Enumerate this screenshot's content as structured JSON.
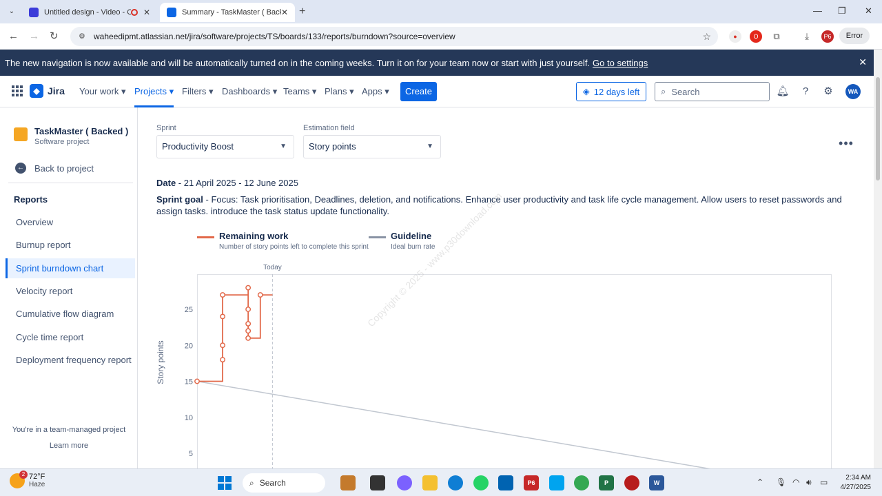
{
  "browser": {
    "tabs": [
      {
        "title": "Untitled design - Video - Ca"
      },
      {
        "title": "Summary - TaskMaster ( Backed"
      }
    ],
    "url": "waheedipmt.atlassian.net/jira/software/projects/TS/boards/133/reports/burndown?source=overview",
    "error_label": "Error"
  },
  "banner": {
    "text": "The new navigation is now available and will be automatically turned on in the coming weeks. Turn it on for your team now or start with just yourself.",
    "link": "Go to settings"
  },
  "topnav": {
    "logo": "Jira",
    "items": [
      "Your work",
      "Projects",
      "Filters",
      "Dashboards",
      "Teams",
      "Plans",
      "Apps"
    ],
    "create": "Create",
    "trial": "12 days left",
    "search_placeholder": "Search",
    "avatar": "WA"
  },
  "sidebar": {
    "project_name": "TaskMaster ( Backed )",
    "project_type": "Software project",
    "back": "Back to project",
    "reports_heading": "Reports",
    "items": [
      "Overview",
      "Burnup report",
      "Sprint burndown chart",
      "Velocity report",
      "Cumulative flow diagram",
      "Cycle time report",
      "Deployment frequency report"
    ],
    "active_item": "Sprint burndown chart",
    "team_note": "You're in a team-managed project",
    "learn_more": "Learn more"
  },
  "filters": {
    "sprint_label": "Sprint",
    "sprint_value": "Productivity Boost",
    "estimation_label": "Estimation field",
    "estimation_value": "Story points"
  },
  "sprint": {
    "date_label": "Date",
    "date_value": " - 21 April 2025 - 12 June 2025",
    "goal_label": "Sprint goal",
    "goal_value": " - Focus: Task prioritisation, Deadlines, deletion, and notifications. Enhance user productivity and task life cycle management. Allow users to reset passwords and assign tasks. introduce the task status update functionality."
  },
  "legend": {
    "remaining_title": "Remaining work",
    "remaining_sub": "Number of story points left to complete this sprint",
    "guideline_title": "Guideline",
    "guideline_sub": "Ideal burn rate"
  },
  "watermark": "Copyright © 2025 - www.p30download.com",
  "colors": {
    "remaining": "#e2694a",
    "guideline": "#8993a4",
    "accent": "#0c66e4",
    "banner": "#253858"
  },
  "chart_data": {
    "type": "line",
    "ylabel": "Story points",
    "today_label": "Today",
    "y_ticks": [
      5,
      10,
      15,
      20,
      25
    ],
    "ylim": [
      3,
      29
    ],
    "xlim": [
      0,
      52
    ],
    "series": [
      {
        "name": "Remaining work",
        "type": "step",
        "x": [
          0,
          2.1,
          2.1,
          2.1,
          2.1,
          2.1,
          4.2,
          4.2,
          4.2,
          4.2,
          4.2,
          5.2,
          5.2,
          6.2
        ],
        "y": [
          15,
          15,
          18,
          20,
          24,
          27,
          27,
          28,
          25,
          22,
          21,
          21,
          27,
          27
        ],
        "markers": [
          [
            0,
            15
          ],
          [
            2.1,
            18
          ],
          [
            2.1,
            20
          ],
          [
            2.1,
            24
          ],
          [
            2.1,
            27
          ],
          [
            4.2,
            28
          ],
          [
            4.2,
            25
          ],
          [
            4.2,
            23
          ],
          [
            4.2,
            22
          ],
          [
            4.2,
            21
          ],
          [
            5.2,
            27
          ]
        ]
      },
      {
        "name": "Guideline",
        "x": [
          0,
          52
        ],
        "y": [
          15,
          0
        ]
      }
    ],
    "today_x": 6.2
  },
  "taskbar": {
    "temperature": "72°F",
    "condition": "Haze",
    "weather_badge": "2",
    "search": "Search",
    "time": "2:34 AM",
    "date": "4/27/2025"
  }
}
